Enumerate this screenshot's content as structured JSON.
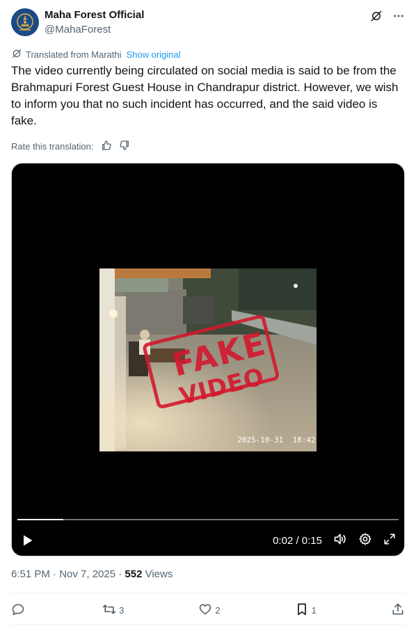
{
  "author": {
    "name": "Maha Forest Official",
    "handle": "@MahaForest"
  },
  "translation": {
    "note": "Translated from Marathi",
    "show_original": "Show original",
    "rate_label": "Rate this translation:"
  },
  "post": {
    "text": "The video currently being circulated on social media is said to be from the Brahmapuri Forest Guest House in Chandrapur district. However, we wish to inform you that no such incident has occurred, and the said video is fake."
  },
  "video": {
    "stamp_line1": "FAKE",
    "stamp_line2": "VIDEO",
    "cctv_timestamp": "2025-10-31  18:42:",
    "time": "0:02 / 0:15",
    "progress_fraction": 0.12
  },
  "meta": {
    "timestamp": "6:51 PM · Nov 7, 2025 · ",
    "views_count": "552",
    "views_label": " Views"
  },
  "actions": {
    "replies": "",
    "reposts": "3",
    "likes": "2",
    "bookmarks": "1"
  },
  "colors": {
    "accent": "#1d9bf0",
    "secondary_text": "#536471",
    "stamp": "#d3182e"
  },
  "icons": [
    "grok-icon",
    "more-icon",
    "translate-icon",
    "thumbs-up-icon",
    "thumbs-down-icon",
    "play-icon",
    "volume-icon",
    "settings-icon",
    "fullscreen-icon",
    "reply-icon",
    "repost-icon",
    "like-icon",
    "bookmark-icon",
    "share-icon"
  ]
}
